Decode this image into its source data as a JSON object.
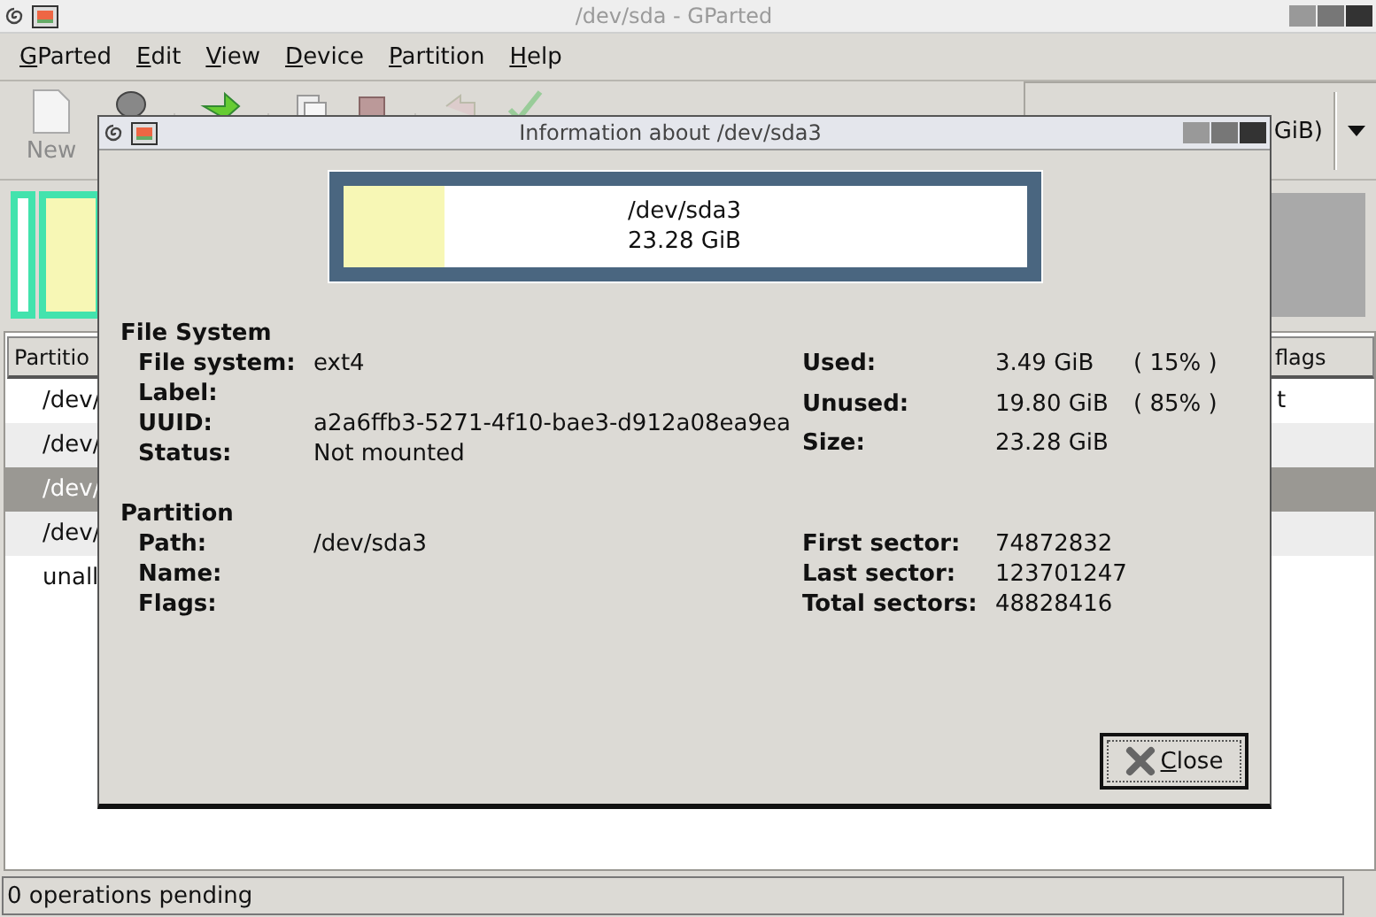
{
  "main_window": {
    "title": "/dev/sda - GParted",
    "menu": [
      {
        "label": "GParted"
      },
      {
        "label": "Edit"
      },
      {
        "label": "View"
      },
      {
        "label": "Device"
      },
      {
        "label": "Partition"
      },
      {
        "label": "Help"
      }
    ],
    "toolbar": {
      "new_label": "New",
      "device_selector": "GiB)"
    },
    "partition_table": {
      "columns": [
        "Partitio",
        "flags"
      ],
      "rows": [
        {
          "partition": "/dev/",
          "flags": "t",
          "selected": false
        },
        {
          "partition": "/dev/",
          "selected": false
        },
        {
          "partition": "/dev/",
          "selected": true
        },
        {
          "partition": "/dev/",
          "selected": false
        },
        {
          "partition": "unall",
          "selected": false
        }
      ]
    },
    "status_bar": "0 operations pending"
  },
  "dialog": {
    "title": "Information about /dev/sda3",
    "graphic": {
      "path": "/dev/sda3",
      "size": "23.28 GiB",
      "level": 0.15
    },
    "sections": [
      {
        "heading": "File System",
        "left": [
          {
            "label": "File system:",
            "value": "ext4"
          },
          {
            "label": "Label:"
          },
          {
            "label": "UUID:",
            "value": "a2a6ffb3-5271-4f10-bae3-d912a08ea9ea"
          },
          {
            "label": "Status:",
            "value": "Not mounted"
          }
        ],
        "right": [
          {
            "label": "Used:",
            "value": "3.49 GiB",
            "percent": "( 15% )"
          },
          {
            "label": "Unused:",
            "value": "19.80 GiB",
            "percent": "( 85% )"
          },
          {
            "label": "Size:",
            "value": "23.28 GiB"
          }
        ]
      },
      {
        "heading": "Partition",
        "left": [
          {
            "label": "Path:",
            "value": "/dev/sda3"
          },
          {
            "label": "Name:"
          },
          {
            "label": "Flags:"
          }
        ],
        "right": [
          {
            "label": "First sector:",
            "value": "74872832"
          },
          {
            "label": "Last sector:",
            "value": "123701247"
          },
          {
            "label": "Total sectors:",
            "value": "48828416"
          }
        ]
      }
    ],
    "close_button": "Close"
  }
}
